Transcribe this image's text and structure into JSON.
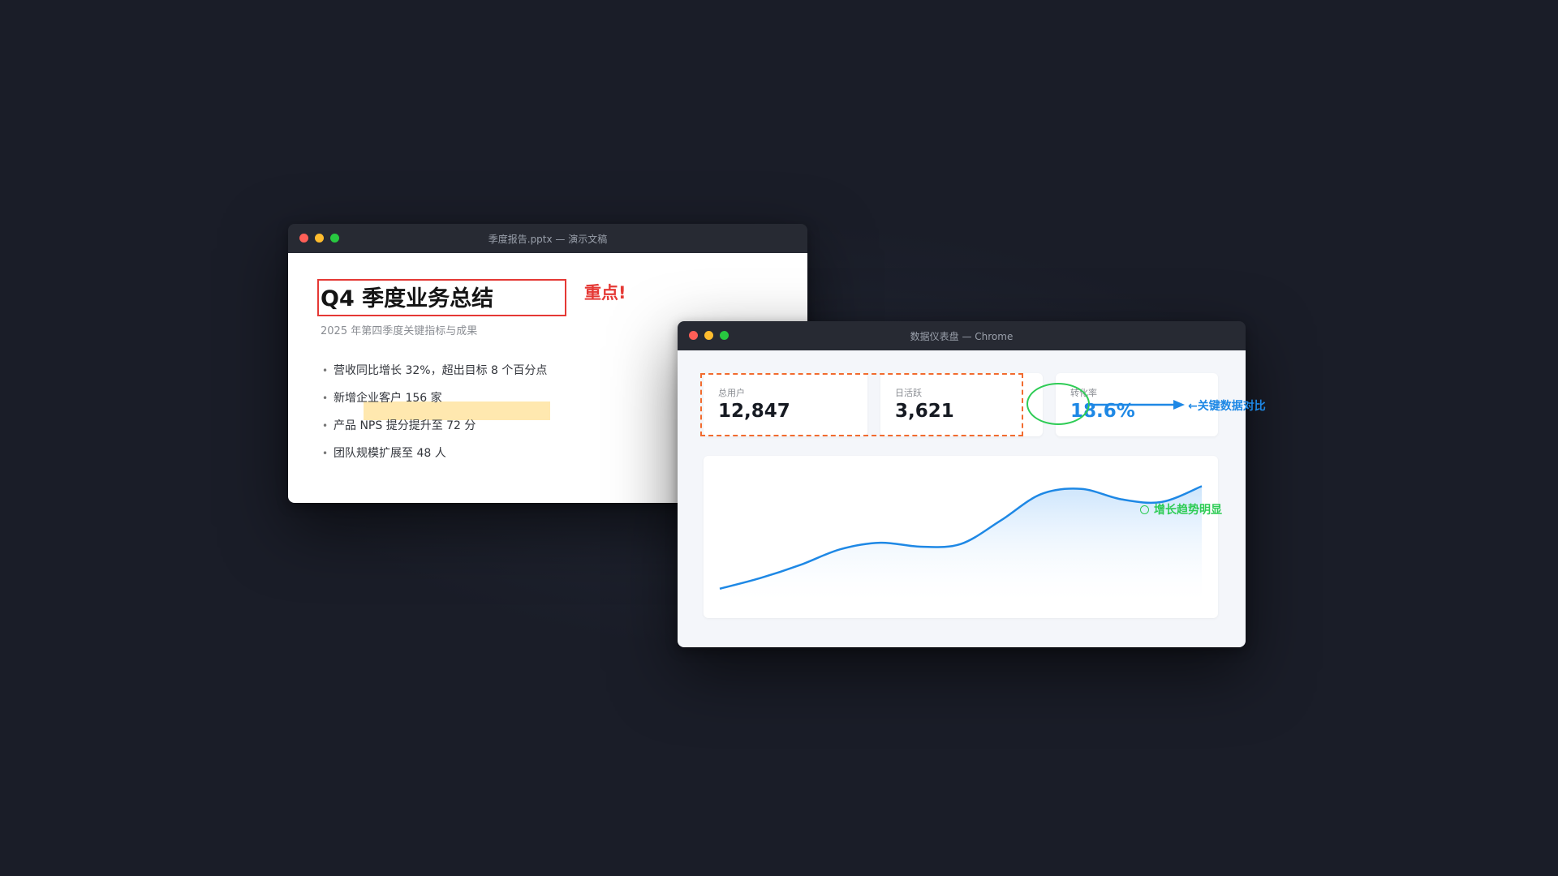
{
  "slide_window": {
    "title": "季度报告.pptx — 演示文稿",
    "slide_title": "Q4 季度业务总结",
    "slide_subtitle": "2025 年第四季度关键指标与成果",
    "bullets": [
      "营收同比增长 32%，超出目标 8 个百分点",
      "新增企业客户 156 家",
      "产品 NPS 提分提升至 72 分",
      "团队规模扩展至 48 人"
    ]
  },
  "dashboard_window": {
    "title": "数据仪表盘 — Chrome",
    "cards": [
      {
        "label": "总用户",
        "value": "12,847"
      },
      {
        "label": "日活跃",
        "value": "3,621"
      },
      {
        "label": "转化率",
        "value": "18.6%"
      }
    ]
  },
  "annotations": {
    "emphasis": "重点!",
    "compare": "←关键数据对比",
    "trend": "增长趋势明显"
  },
  "colors": {
    "annotation_red": "#e53935",
    "annotation_blue": "#1e88e5",
    "annotation_green": "#2ecc55",
    "annotation_orange": "#f26b2f",
    "highlight_yellow": "#ffcc4d"
  },
  "chart_data": {
    "type": "area",
    "title": "",
    "xlabel": "",
    "ylabel": "",
    "grid": false,
    "legend": "none",
    "x": [
      0,
      1,
      2,
      3,
      4,
      5,
      6,
      7,
      8,
      9,
      10,
      11,
      12
    ],
    "values": [
      10,
      18,
      28,
      40,
      45,
      42,
      44,
      62,
      82,
      86,
      78,
      76,
      88
    ],
    "ylim": [
      0,
      100
    ]
  }
}
